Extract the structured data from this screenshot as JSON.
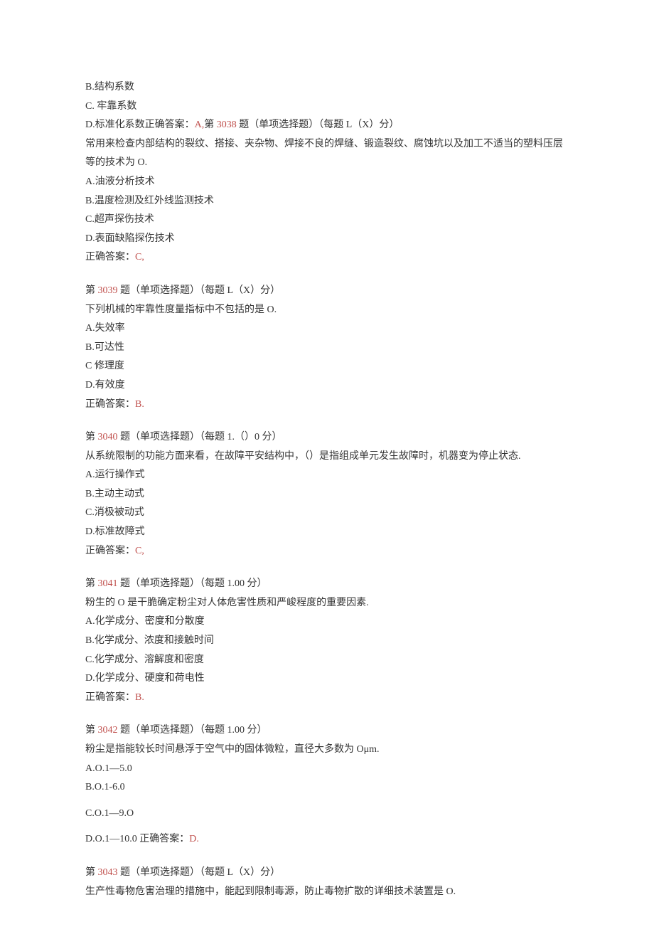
{
  "q3037_continue": {
    "opt_b": "B.结构系数",
    "opt_c": "C. 牢靠系数"
  },
  "q3038": {
    "opt_d_prefix": "D.标准化系数正确答案：",
    "ans_letter": "A,",
    "title_pre": "第 ",
    "num": "3038",
    "title_post": " 题（单项选择题）（每题 L（X）分）",
    "stem": "常用来检查内部结构的裂纹、搭接、夹杂物、焊接不良的焊缝、锻造裂纹、腐蚀坑以及加工不适当的塑料压层等的技术为 O.",
    "opt_a": "A.油液分析技术",
    "opt_b": "B.温度检测及红外线监测技术",
    "opt_c": "C.超声探伤技术",
    "opt_d": "D.表面缺陷探伤技术",
    "ans_pre": "正确答案：",
    "ans": "C,"
  },
  "q3039": {
    "title_pre": "第 ",
    "num": "3039",
    "title_post": " 题（单项选择题）（每题 L（X）分）",
    "stem": "下列机械的牢靠性度量指标中不包括的是 O.",
    "opt_a": "A.失效率",
    "opt_b": "B.可达性",
    "opt_c": "C 修理度",
    "opt_d": "D.有效度",
    "ans_pre": "正确答案：",
    "ans": "B."
  },
  "q3040": {
    "title_pre": "第 ",
    "num": "3040",
    "title_post": " 题（单项选择题）（每题 1.（）0 分）",
    "stem": "从系统限制的功能方面来看，在故障平安结构中，（）是指组成单元发生故障时，机器变为停止状态.",
    "opt_a": "A.运行操作式",
    "opt_b": "B.主动主动式",
    "opt_c": "C.消极被动式",
    "opt_d": "D.标准故障式",
    "ans_pre": "正确答案：",
    "ans": "C,"
  },
  "q3041": {
    "title_pre": "第 ",
    "num": "3041",
    "title_post": " 题（单项选择题）（每题 1.00 分）",
    "stem": "粉生的 O 是干脆确定粉尘对人体危害性质和严峻程度的重要因素.",
    "opt_a": "A.化学成分、密度和分散度",
    "opt_b": "B.化学成分、浓度和接触时间",
    "opt_c": "C.化学成分、溶解度和密度",
    "opt_d": "D.化学成分、硬度和荷电性",
    "ans_pre": "正确答案：",
    "ans": "B."
  },
  "q3042": {
    "title_pre": "第 ",
    "num": "3042",
    "title_post": " 题（单项选择题）（每题 1.00 分）",
    "stem": "粉尘是指能较长时间悬浮于空气中的固体微粒，直径大多数为 Oμm.",
    "opt_a": "A.O.1—5.0",
    "opt_b": "B.O.1-6.0",
    "opt_c": "C.O.1—9.O",
    "opt_d_prefix": "D.O.1—10.0 正确答案：",
    "ans": "D."
  },
  "q3043": {
    "title_pre": "第 ",
    "num": "3043",
    "title_post": " 题（单项选择题）（每题 L（X）分）",
    "stem": "生产性毒物危害治理的措施中，能起到限制毒源，防止毒物扩散的详细技术装置是 O."
  }
}
